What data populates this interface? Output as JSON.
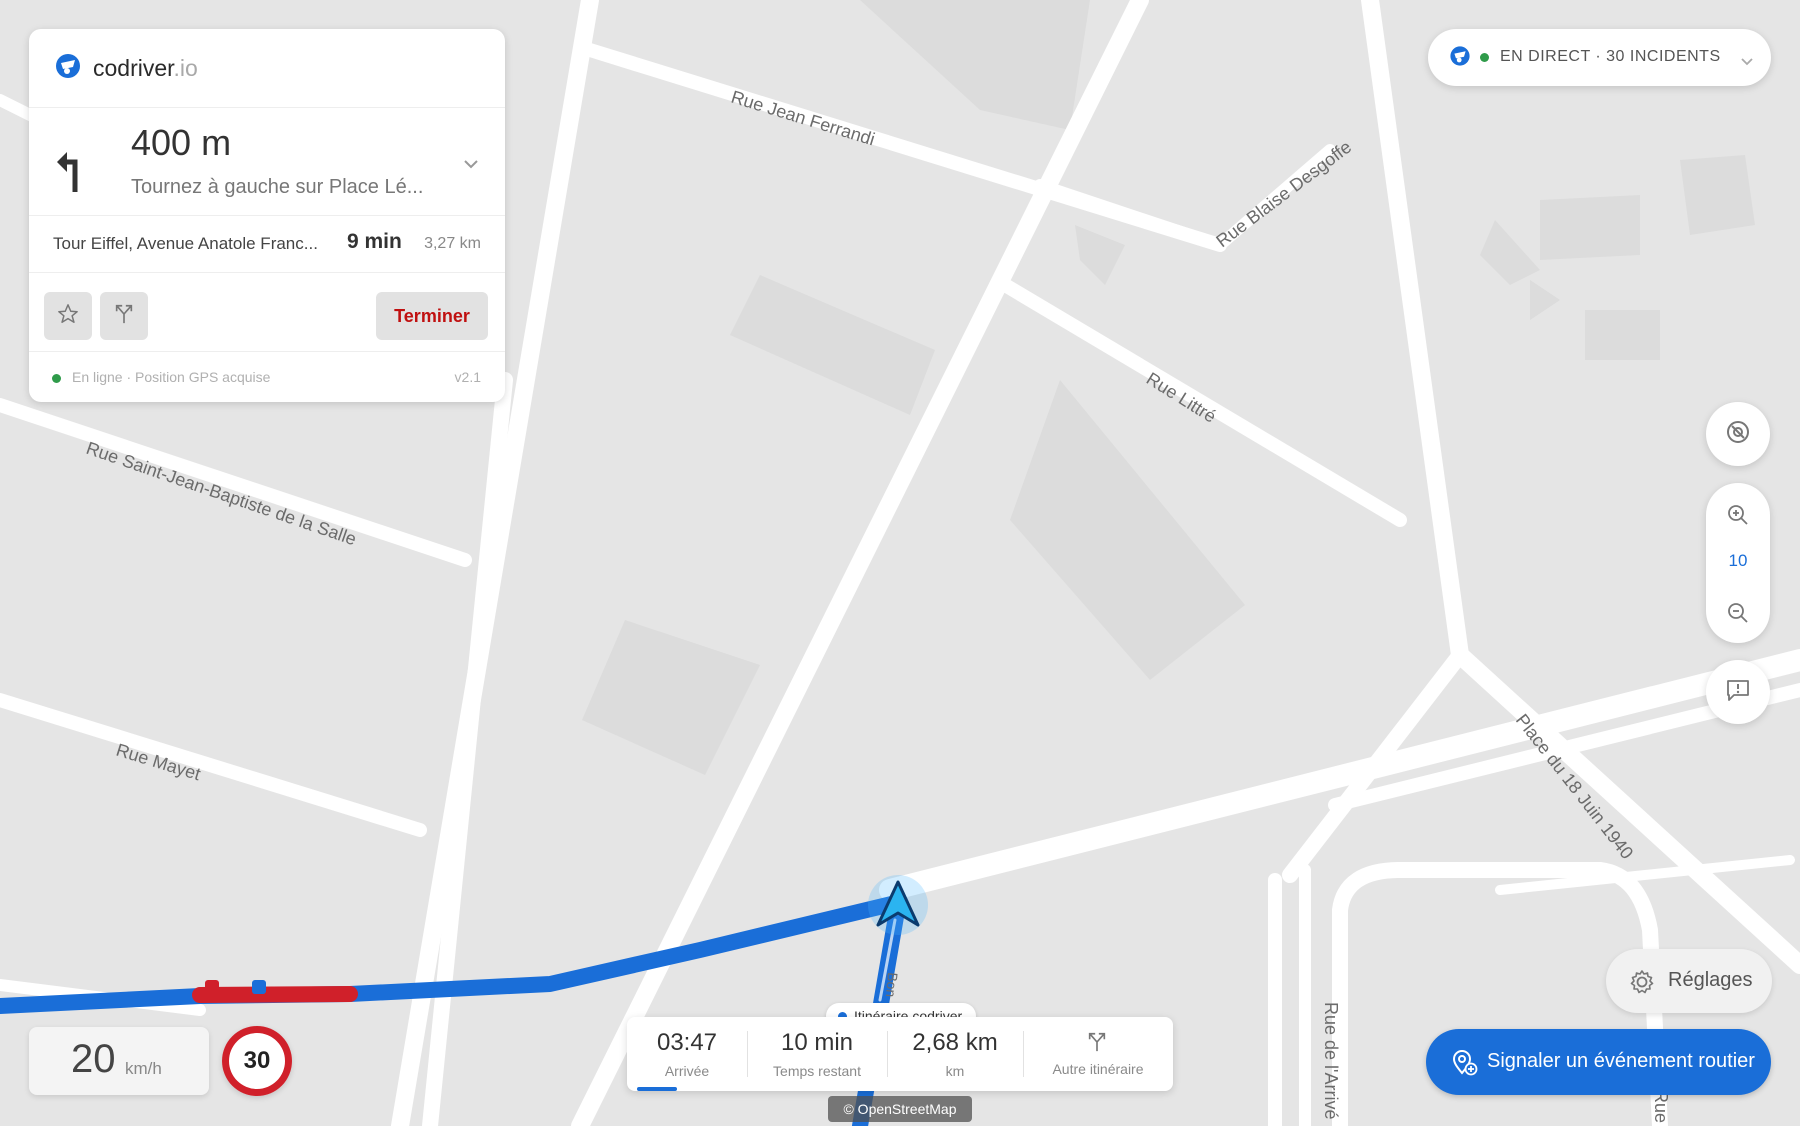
{
  "brand": {
    "name": "codriver",
    "tld": ".io"
  },
  "navigation": {
    "distance": "400 m",
    "instruction": "Tournez à gauche sur Place Lé...",
    "destination": "Tour Eiffel, Avenue Anatole Franc...",
    "eta_duration": "9 min",
    "distance_total": "3,27 km",
    "end_label": "Terminer"
  },
  "status": {
    "text": "En ligne · Position GPS acquise",
    "version": "v2.1"
  },
  "live": {
    "label": "EN DIRECT · 30 INCIDENTS"
  },
  "zoom": {
    "level": "10"
  },
  "speed": {
    "value": "20",
    "unit": "km/h",
    "limit": "30"
  },
  "summary": {
    "arrival_time": "03:47",
    "arrival_label": "Arrivée",
    "remaining_time": "10 min",
    "remaining_label": "Temps restant",
    "distance": "2,68 km",
    "distance_label": "km",
    "alt_route_label": "Autre itinéraire",
    "route_tag": "Itinéraire codriver"
  },
  "attribution": "© OpenStreetMap",
  "settings": {
    "label": "Réglages"
  },
  "report": {
    "label": "Signaler un événement routier"
  },
  "map": {
    "street_labels": [
      "Rue Jean Ferrandi",
      "Rue Blaise Desgoffe",
      "Rue Littré",
      "Rue Saint-Jean-Baptiste de la Salle",
      "Rue Mayet",
      "Place du 18 Juin 1940",
      "Rue de l'Arrivé",
      "Rue",
      "Bon"
    ]
  },
  "colors": {
    "accent": "#1a6ed8",
    "route": "#1a6ed8",
    "congestion": "#d0202a",
    "map_bg": "#e5e5e5",
    "road": "#ffffff"
  }
}
